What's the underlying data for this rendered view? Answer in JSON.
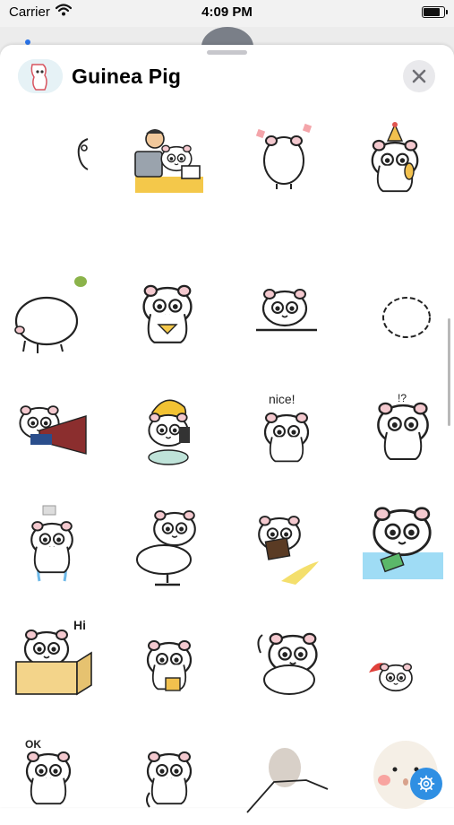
{
  "status_bar": {
    "carrier": "Carrier",
    "time": "4:09 PM",
    "battery_level": 0.85
  },
  "sheet": {
    "title": "Guinea Pig",
    "close_icon": "close-icon",
    "settings_icon": "gear-icon"
  },
  "stickers": {
    "r1c3_text": "nice!",
    "r3c3_text": "!?",
    "r5c1_text": "Hi",
    "r6c1_text": "OK"
  },
  "colors": {
    "accent": "#2f8fe3",
    "sheet_background": "#ffffff",
    "close_button_bg": "#e9e9ec"
  }
}
